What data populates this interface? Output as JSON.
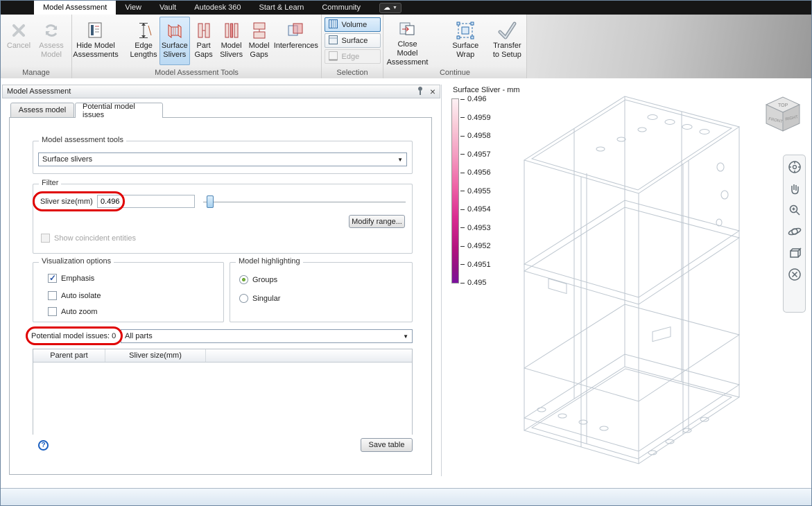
{
  "menubar": {
    "tabs": [
      {
        "label": "Model Assessment"
      },
      {
        "label": "View"
      },
      {
        "label": "Vault"
      },
      {
        "label": "Autodesk 360"
      },
      {
        "label": "Start & Learn"
      },
      {
        "label": "Community"
      }
    ]
  },
  "ribbon": {
    "manage": {
      "group_label": "Manage",
      "cancel": "Cancel",
      "assess_1": "Assess",
      "assess_2": "Model"
    },
    "tools": {
      "group_label": "Model Assessment Tools",
      "hide_1": "Hide Model",
      "hide_2": "Assessments",
      "edge_1": "Edge",
      "edge_2": "Lengths",
      "sliver_1": "Surface",
      "sliver_2": "Slivers",
      "partgap_1": "Part",
      "partgap_2": "Gaps",
      "msliver_1": "Model",
      "msliver_2": "Slivers",
      "mgap_1": "Model",
      "mgap_2": "Gaps",
      "interferences": "Interferences"
    },
    "selection": {
      "group_label": "Selection",
      "volume": "Volume",
      "surface": "Surface",
      "edge": "Edge"
    },
    "continue_group": {
      "group_label": "Continue",
      "close_1": "Close Model",
      "close_2": "Assessment",
      "wrap": "Surface Wrap",
      "transfer_1": "Transfer",
      "transfer_2": "to Setup"
    }
  },
  "panel": {
    "title": "Model Assessment",
    "tab_assess": "Assess model",
    "tab_issues": "Potential model issues",
    "tools_group": {
      "label": "Model assessment tools",
      "value": "Surface slivers"
    },
    "filter_group": {
      "label": "Filter",
      "sliver_size_label": "Sliver size(mm)",
      "sliver_size_value": "0.496",
      "modify_range": "Modify range...",
      "coincident": "Show coincident entities"
    },
    "viz_group": {
      "label": "Visualization options",
      "opt_emphasis": "Emphasis",
      "opt_isolate": "Auto isolate",
      "opt_zoom": "Auto zoom"
    },
    "highlight_group": {
      "label": "Model highlighting",
      "opt_groups": "Groups",
      "opt_singular": "Singular"
    },
    "issues_label": "Potential model issues: 0",
    "parts_filter": "All parts",
    "table": {
      "col_parent": "Parent part",
      "col_sliver": "Sliver size(mm)"
    },
    "save_table": "Save table",
    "help_glyph": "?"
  },
  "viewport": {
    "legend": {
      "title": "Surface Sliver - mm",
      "ticks": [
        "0.496",
        "0.4959",
        "0.4958",
        "0.4957",
        "0.4956",
        "0.4955",
        "0.4954",
        "0.4953",
        "0.4952",
        "0.4951",
        "0.495"
      ]
    },
    "viewcube": {
      "top": "TOP",
      "front": "FRONT",
      "right": "RIGHT"
    }
  },
  "icons": {
    "cloud": "☁",
    "dropdown_arrow": "▼",
    "close": "×"
  }
}
